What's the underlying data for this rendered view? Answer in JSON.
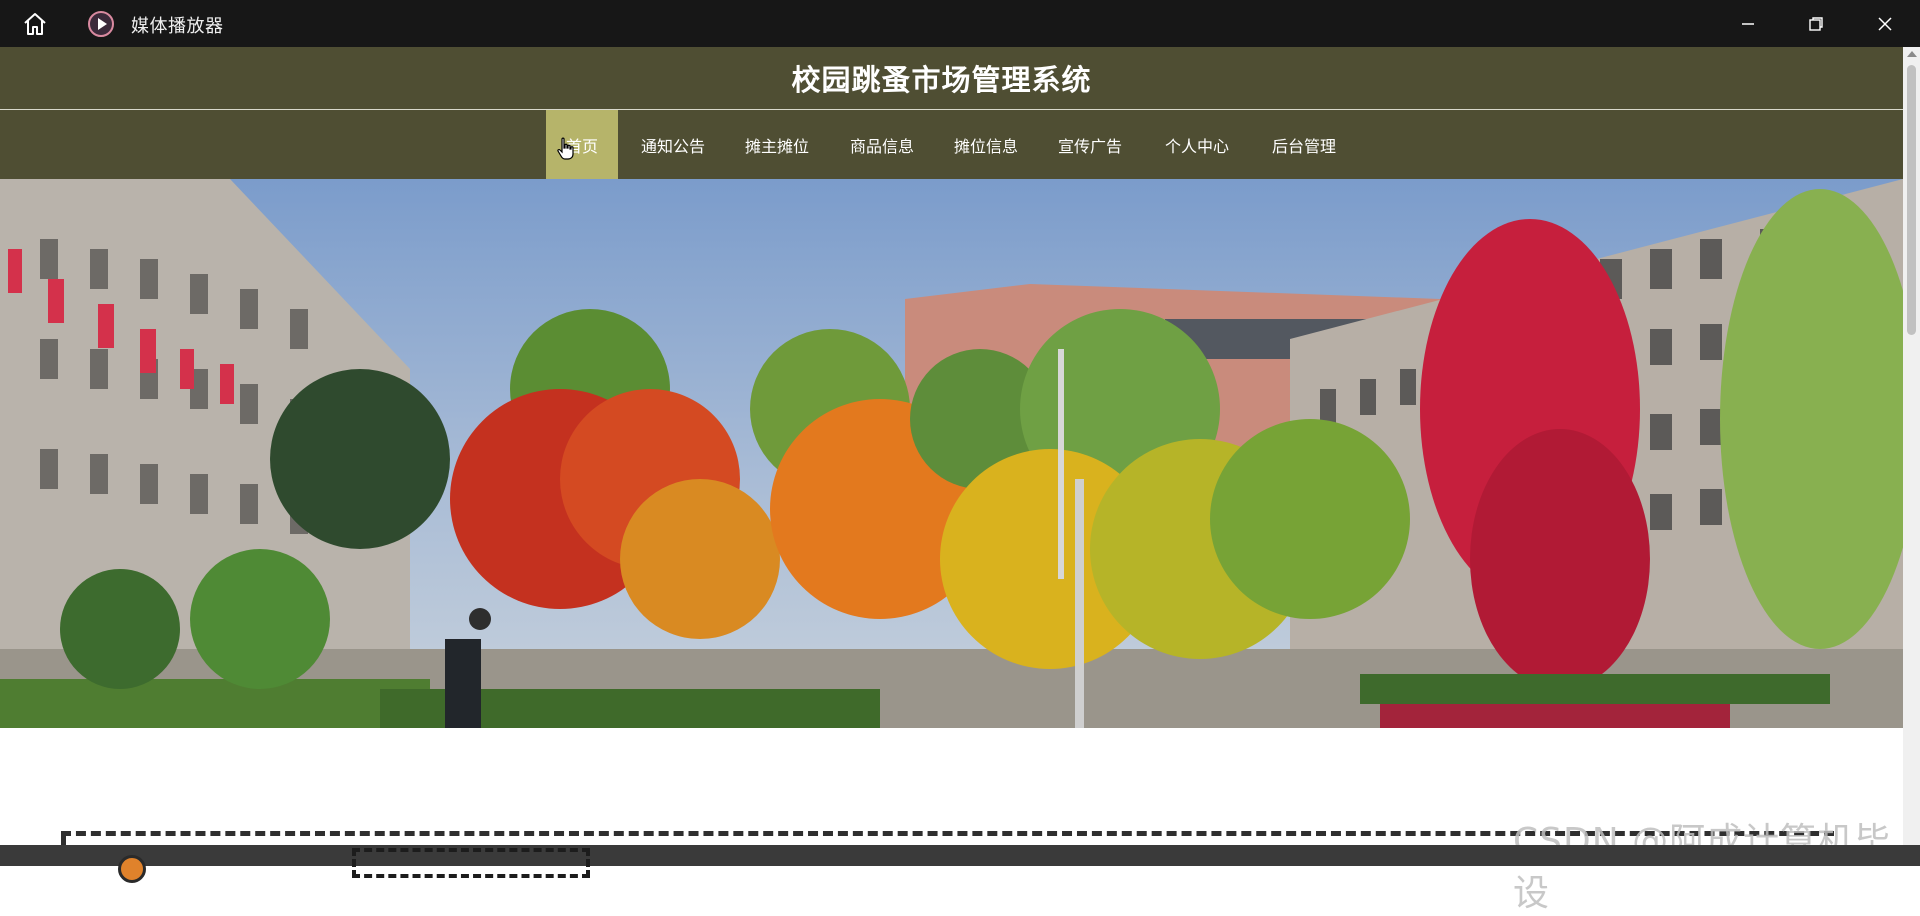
{
  "window": {
    "title": "媒体播放器",
    "icons": [
      "home-icon",
      "media-player-icon",
      "minimize-icon",
      "maximize-icon",
      "close-icon"
    ]
  },
  "site": {
    "title": "校园跳蚤市场管理系统"
  },
  "nav": {
    "items": [
      {
        "label": "首页",
        "active": true
      },
      {
        "label": "通知公告",
        "active": false
      },
      {
        "label": "摊主摊位",
        "active": false
      },
      {
        "label": "商品信息",
        "active": false
      },
      {
        "label": "摊位信息",
        "active": false
      },
      {
        "label": "宣传广告",
        "active": false
      },
      {
        "label": "个人中心",
        "active": false
      },
      {
        "label": "后台管理",
        "active": false
      }
    ]
  },
  "watermark": "CSDN @阿成计算机毕设",
  "colors": {
    "titlebar": "#171717",
    "header": "#4f4e33",
    "nav_active": "#b6b46a",
    "seek_thumb": "#e0822b"
  }
}
